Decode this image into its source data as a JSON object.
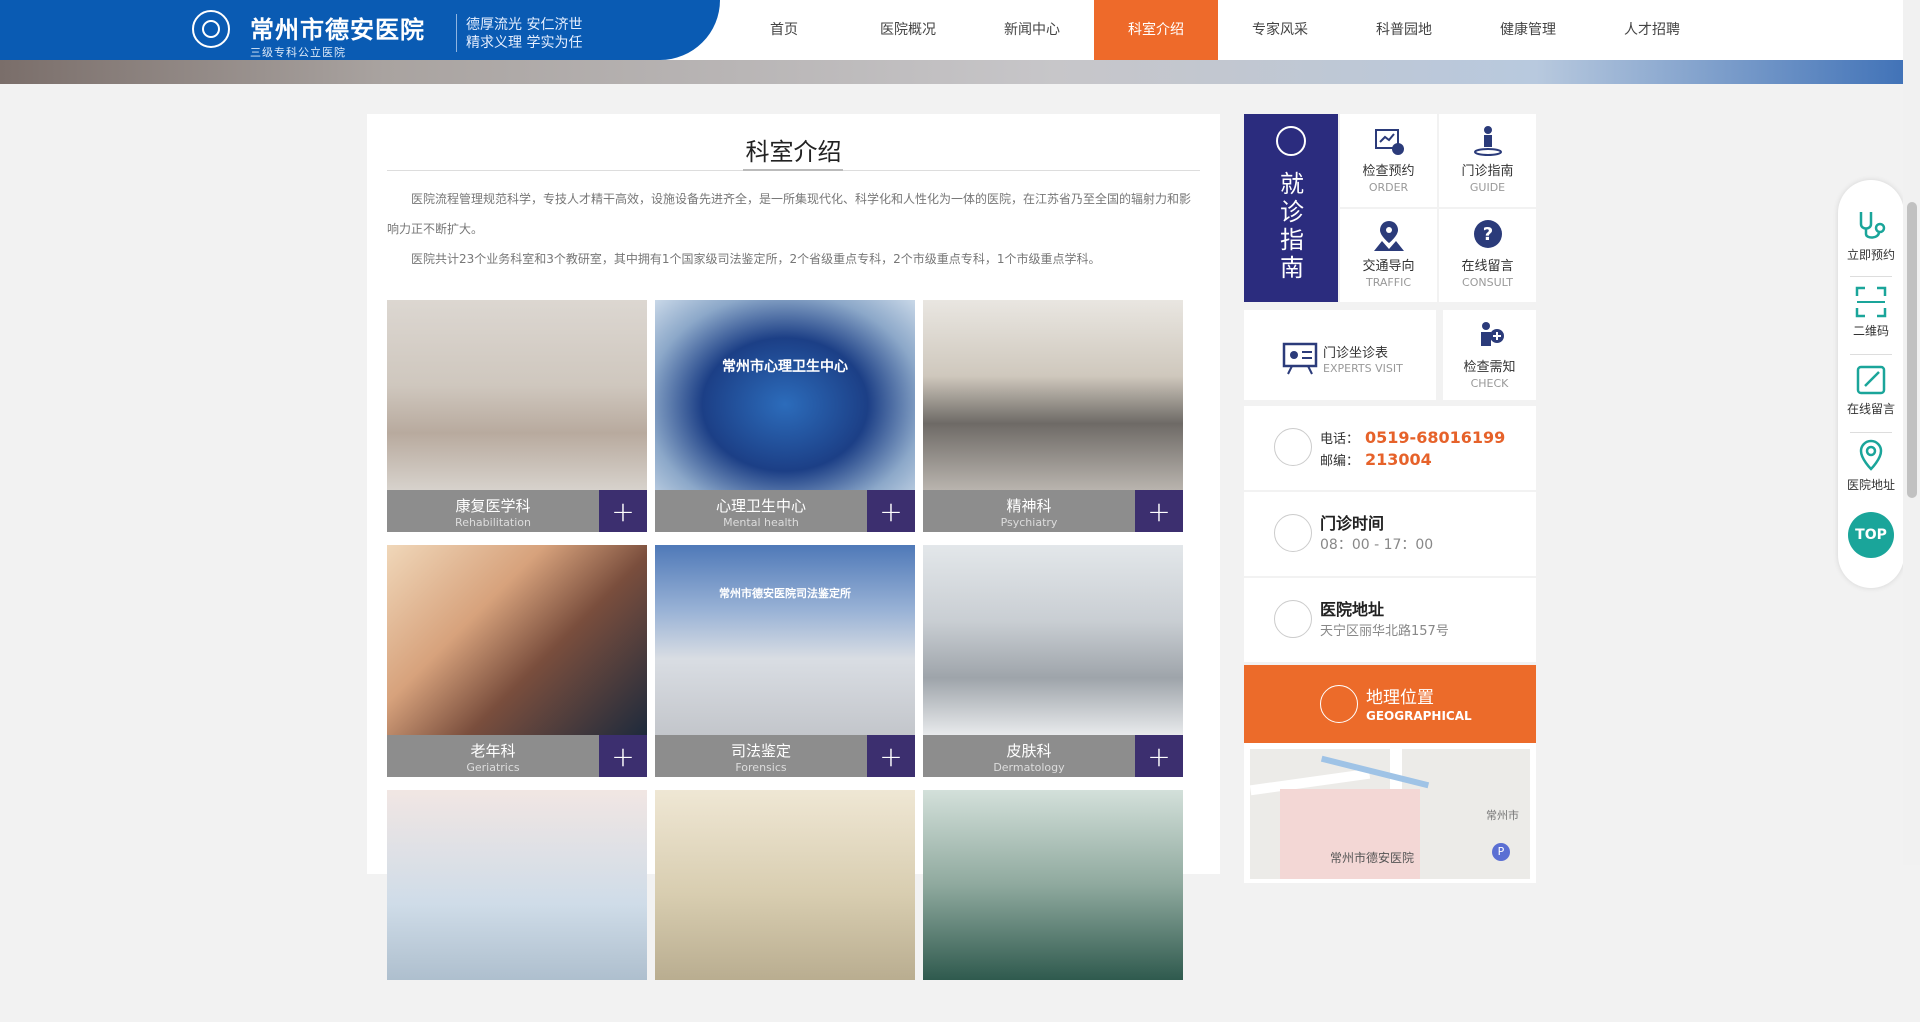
{
  "header": {
    "brand_name": "常州市德安医院",
    "brand_sub": "三级专科公立医院",
    "slogan_line1": "德厚流光 安仁济世",
    "slogan_line2": "精求义理 学实为任",
    "nav": [
      {
        "label": "首页",
        "active": false
      },
      {
        "label": "医院概况",
        "active": false
      },
      {
        "label": "新闻中心",
        "active": false
      },
      {
        "label": "科室介绍",
        "active": true
      },
      {
        "label": "专家风采",
        "active": false
      },
      {
        "label": "科普园地",
        "active": false
      },
      {
        "label": "健康管理",
        "active": false
      },
      {
        "label": "人才招聘",
        "active": false
      }
    ]
  },
  "main": {
    "title": "科室介绍",
    "intro": [
      "医院流程管理规范科学，专技人才精干高效，设施设备先进齐全，是一所集现代化、科学化和人性化为一体的医院，在江苏省乃至全国的辐射力和影响力正不断扩大。",
      "医院共计23个业务科室和3个教研室，其中拥有1个国家级司法鉴定所，2个省级重点专科，2个市级重点专科，1个市级重点学科。"
    ],
    "departments": [
      {
        "cn": "康复医学科",
        "en": "Rehabilitation",
        "photo_text": ""
      },
      {
        "cn": "心理卫生中心",
        "en": "Mental health",
        "photo_text": "常州市心理卫生中心"
      },
      {
        "cn": "精神科",
        "en": "Psychiatry",
        "photo_text": ""
      },
      {
        "cn": "老年科",
        "en": "Geriatrics",
        "photo_text": ""
      },
      {
        "cn": "司法鉴定",
        "en": "Forensics",
        "photo_text": "常州市德安医院司法鉴定所"
      },
      {
        "cn": "皮肤科",
        "en": "Dermatology",
        "photo_text": ""
      },
      {
        "cn": "",
        "en": "",
        "photo_text": ""
      },
      {
        "cn": "",
        "en": "",
        "photo_text": ""
      },
      {
        "cn": "",
        "en": "",
        "photo_text": ""
      }
    ],
    "plus_symbol": "+"
  },
  "sidebar": {
    "guide_title": "就诊指南",
    "tiles": [
      {
        "cn": "检查预约",
        "en": "ORDER",
        "icon": "calendar-chart-icon"
      },
      {
        "cn": "门诊指南",
        "en": "GUIDE",
        "icon": "person-guide-icon"
      },
      {
        "cn": "交通导向",
        "en": "TRAFFIC",
        "icon": "map-pin-icon"
      },
      {
        "cn": "在线留言",
        "en": "CONSULT",
        "icon": "question-icon"
      },
      {
        "cn": "门诊坐诊表",
        "en": "EXPERTS VISIT",
        "icon": "schedule-board-icon"
      },
      {
        "cn": "检查需知",
        "en": "CHECK",
        "icon": "doctor-plus-icon"
      }
    ],
    "phone_label": "电话：",
    "phone": "0519-68016199",
    "zip_label": "邮编：",
    "zip": "213004",
    "hours_title": "门诊时间",
    "hours": "08：00 - 17：00",
    "address_title": "医院地址",
    "address": "天宁区丽华北路157号",
    "geo_cn": "地理位置",
    "geo_en": "GEOGRAPHICAL",
    "map_label": "常州市德安医院",
    "map_label_2": "常州市",
    "map_p": "P"
  },
  "float_bar": {
    "items": [
      {
        "label": "立即预约",
        "icon": "stethoscope-icon"
      },
      {
        "label": "二维码",
        "icon": "qrcode-scan-icon"
      },
      {
        "label": "在线留言",
        "icon": "edit-icon"
      },
      {
        "label": "医院地址",
        "icon": "location-icon"
      }
    ],
    "top_label": "TOP"
  },
  "colors": {
    "brand_blue": "#0a5bb3",
    "accent_orange": "#ee6a2a",
    "guide_navy": "#2b2c7e",
    "plus_purple": "#3c2f6f",
    "top_teal": "#1aa59a"
  }
}
